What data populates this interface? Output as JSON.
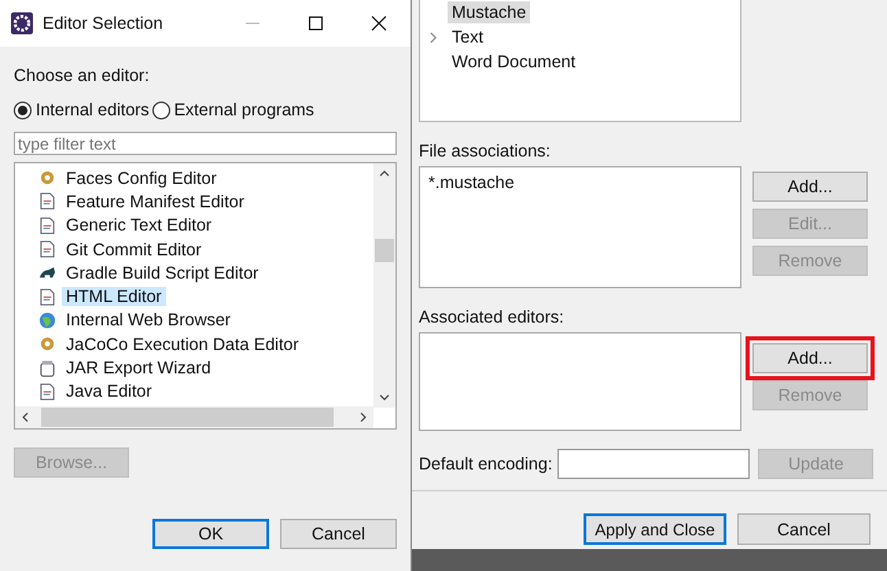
{
  "dialog": {
    "title": "Editor Selection",
    "prompt": "Choose an editor:",
    "options": [
      {
        "label": "Internal editors",
        "selected": true
      },
      {
        "label": "External programs",
        "selected": false
      }
    ],
    "filter": {
      "placeholder": "type filter text"
    },
    "editors": [
      {
        "label": "Faces Config Editor",
        "selected": false
      },
      {
        "label": "Feature Manifest Editor",
        "selected": false
      },
      {
        "label": "Generic Text Editor",
        "selected": false
      },
      {
        "label": "Git Commit Editor",
        "selected": false
      },
      {
        "label": "Gradle Build Script Editor",
        "selected": false
      },
      {
        "label": "HTML Editor",
        "selected": true
      },
      {
        "label": "Internal Web Browser",
        "selected": false
      },
      {
        "label": "JaCoCo Execution Data Editor",
        "selected": false
      },
      {
        "label": "JAR Export Wizard",
        "selected": false
      },
      {
        "label": "Java Editor",
        "selected": false
      }
    ],
    "browse": {
      "label": "Browse...",
      "disabled": true
    },
    "buttons": [
      {
        "label": "OK",
        "default": true
      },
      {
        "label": "Cancel",
        "default": false
      }
    ]
  },
  "preferences": {
    "content_types": [
      {
        "label": "Mustache",
        "selected": true,
        "expandable": false
      },
      {
        "label": "Text",
        "selected": false,
        "expandable": true
      },
      {
        "label": "Word Document",
        "selected": false,
        "expandable": false
      }
    ],
    "file_associations": {
      "label": "File associations:",
      "items": [
        "*.mustache"
      ],
      "buttons": [
        {
          "label": "Add...",
          "disabled": false,
          "highlighted": false
        },
        {
          "label": "Edit...",
          "disabled": true,
          "highlighted": false
        },
        {
          "label": "Remove",
          "disabled": true,
          "highlighted": false
        }
      ]
    },
    "associated_editors": {
      "label": "Associated editors:",
      "buttons": [
        {
          "label": "Add...",
          "disabled": false,
          "highlighted": true
        },
        {
          "label": "Remove",
          "disabled": true,
          "highlighted": false
        }
      ]
    },
    "encoding": {
      "label": "Default encoding:",
      "button": {
        "label": "Update",
        "disabled": true
      }
    },
    "buttons": [
      {
        "label": "Apply and Close",
        "default": true
      },
      {
        "label": "Cancel",
        "default": false
      }
    ]
  }
}
